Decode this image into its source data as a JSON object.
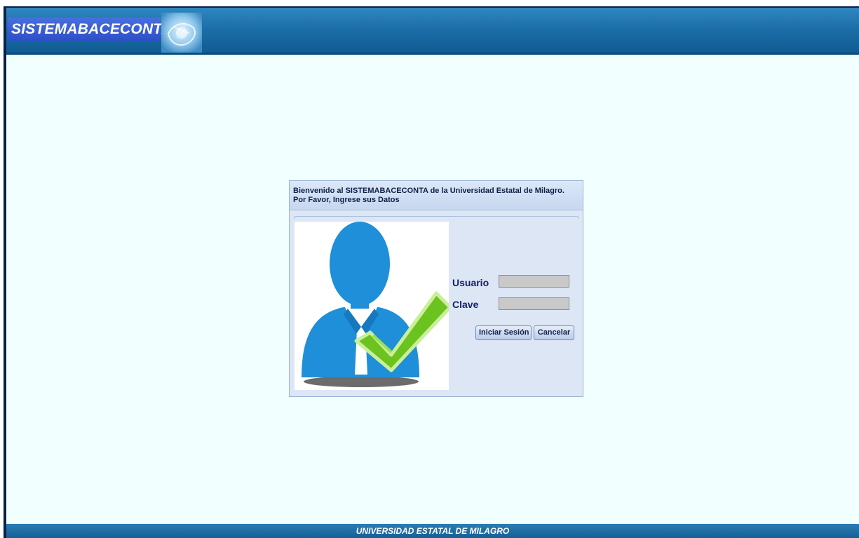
{
  "header": {
    "app_title": "SISTEMABACECONTA",
    "logo_icon": "globe-logo-icon"
  },
  "login": {
    "welcome_message": "Bienvenido al SISTEMABACECONTA de la Universidad Estatal de Milagro. Por Favor, Ingrese sus Datos",
    "illustration": "user-check-icon",
    "username_label": "Usuario",
    "username_value": "",
    "password_label": "Clave",
    "password_value": "",
    "login_button": "Iniciar Sesión",
    "cancel_button": "Cancelar"
  },
  "footer": {
    "text": "UNIVERSIDAD ESTATAL DE MILAGRO"
  },
  "colors": {
    "header_blue": "#1c6ea8",
    "title_bg": "#2d4fc8",
    "page_bg": "#f2ffff",
    "panel_bg": "#dde6f5",
    "label_text": "#14206a",
    "avatar_blue": "#1e8fd8",
    "check_green": "#6cc21e"
  }
}
